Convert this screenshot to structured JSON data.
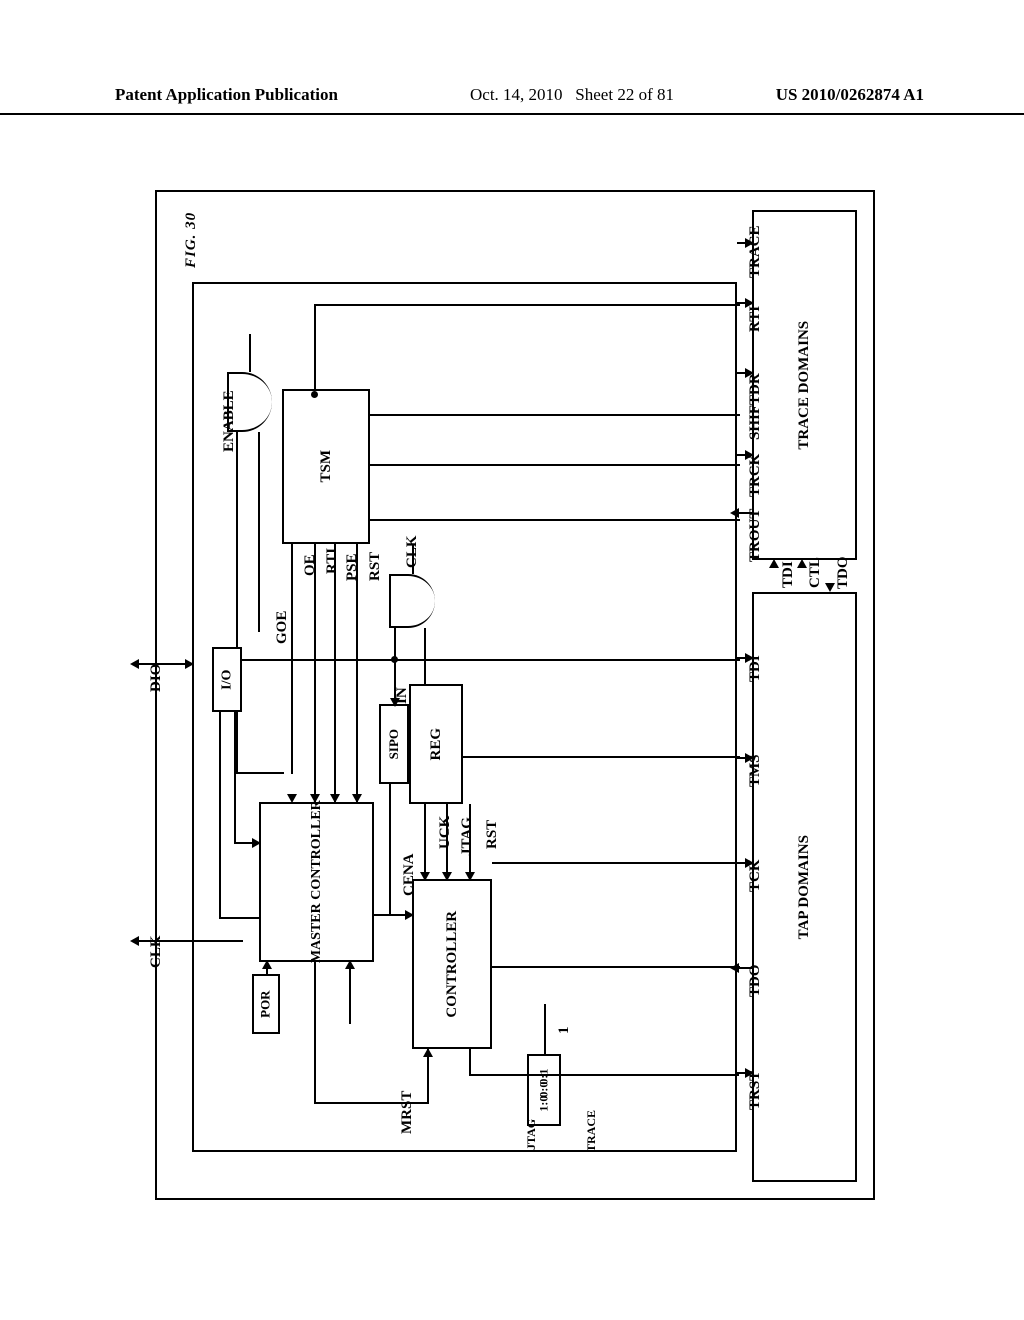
{
  "header": {
    "left": "Patent Application Publication",
    "mid_date": "Oct. 14, 2010",
    "mid_sheet": "Sheet 22 of 81",
    "right": "US 2010/0262874 A1"
  },
  "figure_title": "FIG. 30",
  "blocks": {
    "trace_domains": "TRACE\nDOMAINS",
    "tap_domains": "TAP\nDOMAINS",
    "tsm": "TSM",
    "reg": "REG",
    "sipo": "SIPO",
    "controller": "CONTROLLER",
    "master_controller": "MASTER\nCONTROLLER",
    "por": "POR",
    "io": "I/O"
  },
  "pads": {
    "dio": "DIO",
    "clk_ext": "CLK"
  },
  "signals": {
    "enable": "ENABLE",
    "oe": "OE",
    "rti": "RTI",
    "pse": "PSE",
    "rst": "RST",
    "goe": "GOE",
    "in": "IN",
    "cena": "CENA",
    "mrst": "MRST",
    "uck": "UCK",
    "jtag": "JTAG",
    "rst2": "RST",
    "clk_int": "CLK",
    "trace_out": "TRACE",
    "jtag_out": "JTAG",
    "one": "1",
    "table_01": "0:1",
    "table_00": "0:0",
    "table_10": "1:0"
  },
  "pins_right": {
    "trace": "TRACE",
    "rti": "RTI",
    "shiftdr": "SHIFTDR",
    "trck": "TRCK",
    "trout": "TROUT",
    "tdi": "TDI",
    "ctl": "CTL",
    "tdo": "TDO",
    "tms": "TMS",
    "tck": "TCK",
    "tdo2": "TDO",
    "trst": "TRST"
  }
}
